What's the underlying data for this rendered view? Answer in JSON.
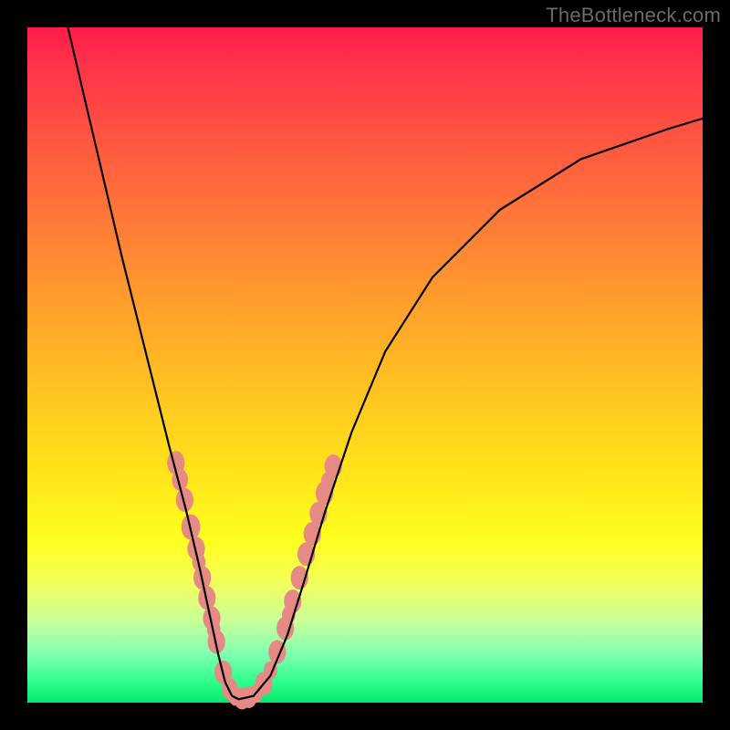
{
  "watermark": "TheBottleneck.com",
  "colors": {
    "frame": "#000000",
    "watermark": "#6a6a6a",
    "curve": "#000000",
    "dot": "#e58a85",
    "gradient_stops": [
      {
        "pct": 0,
        "hex": "#ff1c4a"
      },
      {
        "pct": 6,
        "hex": "#ff3549"
      },
      {
        "pct": 18,
        "hex": "#ff5a40"
      },
      {
        "pct": 30,
        "hex": "#ff7d36"
      },
      {
        "pct": 42,
        "hex": "#ffa22b"
      },
      {
        "pct": 54,
        "hex": "#ffc421"
      },
      {
        "pct": 66,
        "hex": "#ffe41a"
      },
      {
        "pct": 76,
        "hex": "#feff1e"
      },
      {
        "pct": 82,
        "hex": "#f4ff58"
      },
      {
        "pct": 88,
        "hex": "#c9ff9b"
      },
      {
        "pct": 93,
        "hex": "#7dffb0"
      },
      {
        "pct": 97,
        "hex": "#2bff8a"
      },
      {
        "pct": 100,
        "hex": "#06e86c"
      }
    ]
  },
  "chart_data": {
    "type": "line",
    "title": "",
    "xlabel": "",
    "ylabel": "",
    "xlim": [
      0,
      100
    ],
    "ylim": [
      0,
      100
    ],
    "note": "No axis tick labels visible; values are relative percentages estimated from pixel positions within the 740×740 plot area.",
    "series": [
      {
        "name": "bottleneck-curve",
        "x": [
          6,
          10,
          14,
          18,
          21,
          23.5,
          25.5,
          27,
          28.3,
          29.3,
          30.3,
          31.3,
          33.5,
          36,
          38.5,
          41,
          44,
          48,
          53,
          60,
          70,
          82,
          95,
          100
        ],
        "y": [
          100,
          83,
          66,
          50,
          38,
          28.5,
          20,
          13,
          7,
          3,
          1,
          0.5,
          1,
          4,
          10,
          18,
          28,
          40,
          52,
          63,
          73,
          80.5,
          85,
          86.5
        ]
      }
    ],
    "cluster_points": {
      "name": "highlight-dots",
      "points": [
        {
          "x": 22.0,
          "y": 35.5,
          "r": 1.3
        },
        {
          "x": 22.6,
          "y": 33.0,
          "r": 1.2
        },
        {
          "x": 23.3,
          "y": 30.0,
          "r": 1.3
        },
        {
          "x": 24.2,
          "y": 26.0,
          "r": 1.4
        },
        {
          "x": 25.0,
          "y": 22.8,
          "r": 1.3
        },
        {
          "x": 25.4,
          "y": 20.8,
          "r": 1.0
        },
        {
          "x": 25.9,
          "y": 18.5,
          "r": 1.3
        },
        {
          "x": 26.6,
          "y": 15.5,
          "r": 1.3
        },
        {
          "x": 27.3,
          "y": 12.5,
          "r": 1.3
        },
        {
          "x": 27.6,
          "y": 10.8,
          "r": 1.0
        },
        {
          "x": 28.0,
          "y": 9.0,
          "r": 1.3
        },
        {
          "x": 29.0,
          "y": 4.5,
          "r": 1.3
        },
        {
          "x": 30.0,
          "y": 2.0,
          "r": 1.2
        },
        {
          "x": 30.8,
          "y": 0.9,
          "r": 1.0
        },
        {
          "x": 31.8,
          "y": 0.6,
          "r": 1.2
        },
        {
          "x": 32.8,
          "y": 0.8,
          "r": 1.2
        },
        {
          "x": 33.8,
          "y": 1.3,
          "r": 1.0
        },
        {
          "x": 35.0,
          "y": 2.8,
          "r": 1.3
        },
        {
          "x": 36.0,
          "y": 4.8,
          "r": 1.0
        },
        {
          "x": 37.0,
          "y": 7.5,
          "r": 1.3
        },
        {
          "x": 38.2,
          "y": 11.0,
          "r": 1.3
        },
        {
          "x": 38.7,
          "y": 13.0,
          "r": 1.0
        },
        {
          "x": 39.3,
          "y": 15.0,
          "r": 1.3
        },
        {
          "x": 40.3,
          "y": 18.5,
          "r": 1.3
        },
        {
          "x": 41.3,
          "y": 22.0,
          "r": 1.3
        },
        {
          "x": 42.2,
          "y": 25.0,
          "r": 1.3
        },
        {
          "x": 43.1,
          "y": 28.0,
          "r": 1.3
        },
        {
          "x": 44.0,
          "y": 31.0,
          "r": 1.3
        },
        {
          "x": 44.5,
          "y": 32.8,
          "r": 1.0
        },
        {
          "x": 45.3,
          "y": 35.0,
          "r": 1.3
        }
      ]
    }
  }
}
